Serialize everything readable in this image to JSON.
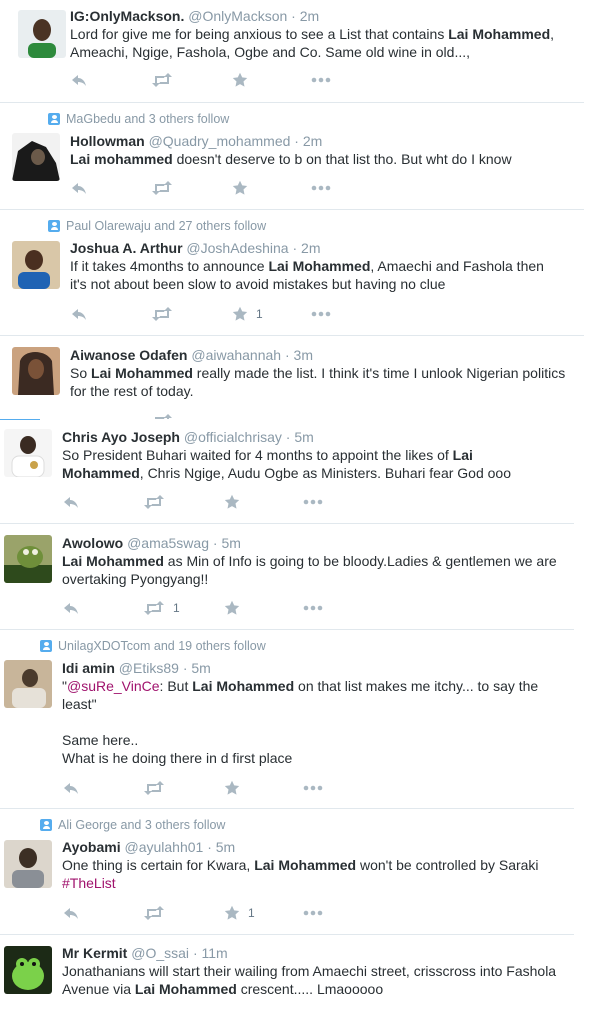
{
  "tweets": [
    {
      "name": "IG:OnlyMackson.",
      "handle": "@OnlyMackson",
      "time": "· 2m",
      "text_parts": [
        "Lord for give me for being anxious to see a List that contains ",
        "Lai Mohammed",
        ",",
        "Ameachi, Ngige, Fashola, Ogbe and Co. Same old wine in old...,"
      ],
      "avatar_colors": [
        "#e9eef0",
        "#2d8a3c"
      ]
    },
    {
      "context": "MaGbedu and 3 others follow",
      "name": "Hollowman",
      "handle": "@Quadry_mohammed",
      "time": "· 2m",
      "text_parts": [
        "Lai mohammed",
        " doesn't deserve to b on that list tho.  But wht do I know"
      ],
      "avatar_colors": [
        "#1a1a1a",
        "#6b5a4a"
      ]
    },
    {
      "context": "Paul Olarewaju and 27 others follow",
      "name": "Joshua A. Arthur",
      "handle": "@JoshAdeshina",
      "time": "· 2m",
      "text_parts": [
        "If it takes 4months to announce ",
        "Lai Mohammed",
        ", Amaechi and Fashola then",
        "it's not about been slow to avoid mistakes but having no clue"
      ],
      "favorite_count": "1",
      "avatar_colors": [
        "#d9c7a8",
        "#1f63b4"
      ]
    },
    {
      "name": "Aiwanose Odafen",
      "handle": "@aiwahannah",
      "time": "· 3m",
      "text_parts": [
        "So ",
        "Lai Mohammed",
        " really made the list. I think it's time I unlook Nigerian politics",
        "for the rest of today."
      ],
      "avatar_colors": [
        "#3b2a22",
        "#caa27f"
      ]
    },
    {
      "name": "Chris Ayo Joseph",
      "handle": "@officialchrisay",
      "time": "· 5m",
      "text_parts": [
        "So President Buhari waited for 4 months to appoint the likes of ",
        "Lai",
        "Mohammed",
        ", Chris Ngige, Audu Ogbe as Ministers. Buhari fear God ooo"
      ],
      "avatar_colors": [
        "#f5f5f5",
        "#3a2b22"
      ]
    },
    {
      "name": "Awolowo",
      "handle": "@ama5swag",
      "time": "· 5m",
      "text_parts": [
        "Lai Mohammed",
        " as Min of Info is going to be bloody.Ladies & gentlemen we are",
        "overtaking Pyongyang!!"
      ],
      "retweet_count": "1",
      "avatar_colors": [
        "#6f8f3a",
        "#2e4a1c"
      ]
    },
    {
      "context": "UnilagXDOTcom and 19 others follow",
      "name": "Idi amin",
      "handle": "@Etiks89",
      "time": "· 5m",
      "text_parts": [
        "\"",
        "@suRe_VinCe",
        ": But ",
        "Lai Mohammed",
        " on that list makes me itchy... to say the",
        "least\"",
        "Same here..",
        "What is he doing there in d first place"
      ],
      "avatar_colors": [
        "#c8b59a",
        "#4a3a2c"
      ]
    },
    {
      "context": "Ali George and 3 others follow",
      "name": "Ayobami",
      "handle": "@ayulahh01",
      "time": "· 5m",
      "text_parts": [
        "One thing is certain for Kwara, ",
        "Lai Mohammed",
        " won't be controlled by Saraki",
        "#TheList"
      ],
      "favorite_count": "1",
      "avatar_colors": [
        "#dcd6cc",
        "#3c2f24"
      ]
    },
    {
      "name": "Mr Kermit",
      "handle": "@O_ssai",
      "time": "· 11m",
      "text_parts": [
        "Jonathanians will start their wailing from Amaechi street, crisscross into Fashola",
        "Avenue via ",
        "Lai Mohammed",
        " crescent..... Lmaooooo"
      ],
      "avatar_colors": [
        "#1c2a16",
        "#7bd14a"
      ]
    }
  ],
  "action_icons": [
    "reply-icon",
    "retweet-icon",
    "favorite-icon",
    "more-icon"
  ]
}
